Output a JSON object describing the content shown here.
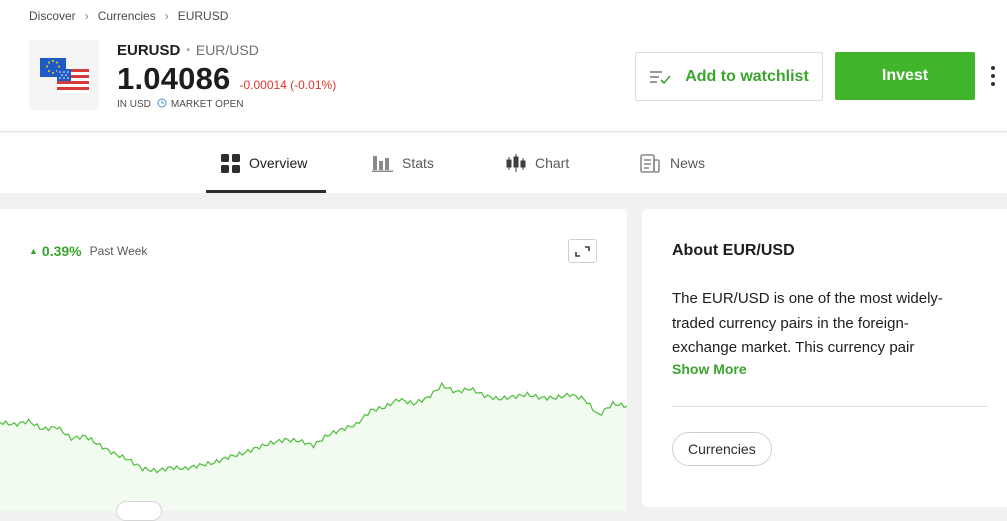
{
  "breadcrumb": {
    "items": [
      "Discover",
      "Currencies",
      "EURUSD"
    ]
  },
  "instrument": {
    "symbol": "EURUSD",
    "pair": "EUR/USD",
    "price": "1.04086",
    "change": "-0.00014 (-0.01%)",
    "currency_note": "IN USD",
    "market_status": "MARKET OPEN"
  },
  "actions": {
    "watchlist_label": "Add to watchlist",
    "invest_label": "Invest"
  },
  "tabs": [
    {
      "label": "Overview",
      "icon": "grid-icon",
      "active": true
    },
    {
      "label": "Stats",
      "icon": "bar-chart-icon",
      "active": false
    },
    {
      "label": "Chart",
      "icon": "candlestick-icon",
      "active": false
    },
    {
      "label": "News",
      "icon": "news-icon",
      "active": false
    }
  ],
  "performance": {
    "change_pct": "0.39%",
    "period": "Past Week",
    "direction": "up"
  },
  "chart_data": {
    "type": "area",
    "series": [
      {
        "values": [
          0.42,
          0.4,
          0.43,
          0.36,
          0.38,
          0.28,
          0.3,
          0.22,
          0.15,
          0.1,
          0.02,
          0.0,
          0.03,
          0.02,
          0.05,
          0.07,
          0.12,
          0.15,
          0.2,
          0.24,
          0.27,
          0.26,
          0.22,
          0.31,
          0.36,
          0.4,
          0.52,
          0.55,
          0.62,
          0.58,
          0.63,
          0.74,
          0.68,
          0.71,
          0.65,
          0.62,
          0.64,
          0.66,
          0.63,
          0.63,
          0.66,
          0.62,
          0.48,
          0.58,
          0.56
        ]
      }
    ],
    "colors": {
      "line": "#4dbd3a",
      "fill": "#f2fbf0"
    }
  },
  "about": {
    "title": "About EUR/USD",
    "description": "The EUR/USD is one of the most widely-traded currency pairs in the foreign-exchange market. This currency pair",
    "show_more": "Show More",
    "tag": "Currencies"
  },
  "colors": {
    "accent_green": "#40b52b",
    "negative_red": "#e0342b"
  }
}
